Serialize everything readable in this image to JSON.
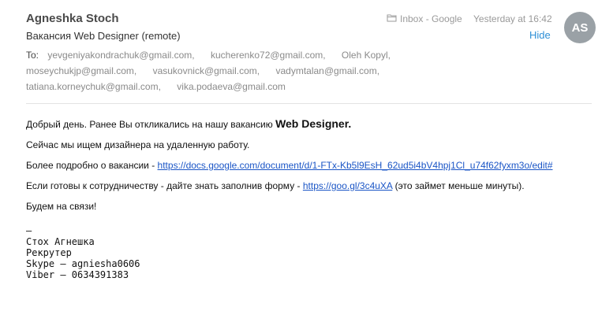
{
  "header": {
    "sender": "Agneshka Stoch",
    "subject": "Вакансия Web Designer (remote)",
    "mailbox": "Inbox - Google",
    "datetime": "Yesterday at 16:42",
    "hide_label": "Hide",
    "avatar_initials": "AS",
    "avatar_color": "#9aa1a6",
    "link_color": "#2d8fd6"
  },
  "recipients": {
    "label": "To:",
    "list": [
      "yevgeniyakondrachuk@gmail.com,",
      "kucherenko72@gmail.com,",
      "Oleh Kopyl,",
      "moseychukjp@gmail.com,",
      "vasukovnick@gmail.com,",
      "vadymtalan@gmail.com,",
      "tatiana.korneychuk@gmail.com,",
      "vika.podaeva@gmail.com"
    ]
  },
  "body": {
    "greeting_text": "Добрый день. Ранее Вы откликались на нашу вакансию ",
    "greeting_bold": "Web Designer.",
    "line2": "Сейчас мы ищем дизайнера на удаленную работу.",
    "line3_text": "Более подробно о вакансии - ",
    "line3_link": "https://docs.google.com/document/d/1-FTx-Kb5l9EsH_62ud5i4bV4hpj1Cl_u74f62fyxm3o/edit#",
    "line4_text": "Если готовы к сотрудничеству - дайте знать заполнив форму - ",
    "line4_link": "https://goo.gl/3c4uXA",
    "line4_suffix": " (это займет меньше минуты).",
    "line5": "Будем на связи!",
    "link_color": "#1a55c6"
  },
  "signature": {
    "dash": "—",
    "name": "Стох Агнешка",
    "role": "Рекрутер",
    "skype": "Skype — agniesha0606",
    "viber": "Viber — 0634391383"
  }
}
